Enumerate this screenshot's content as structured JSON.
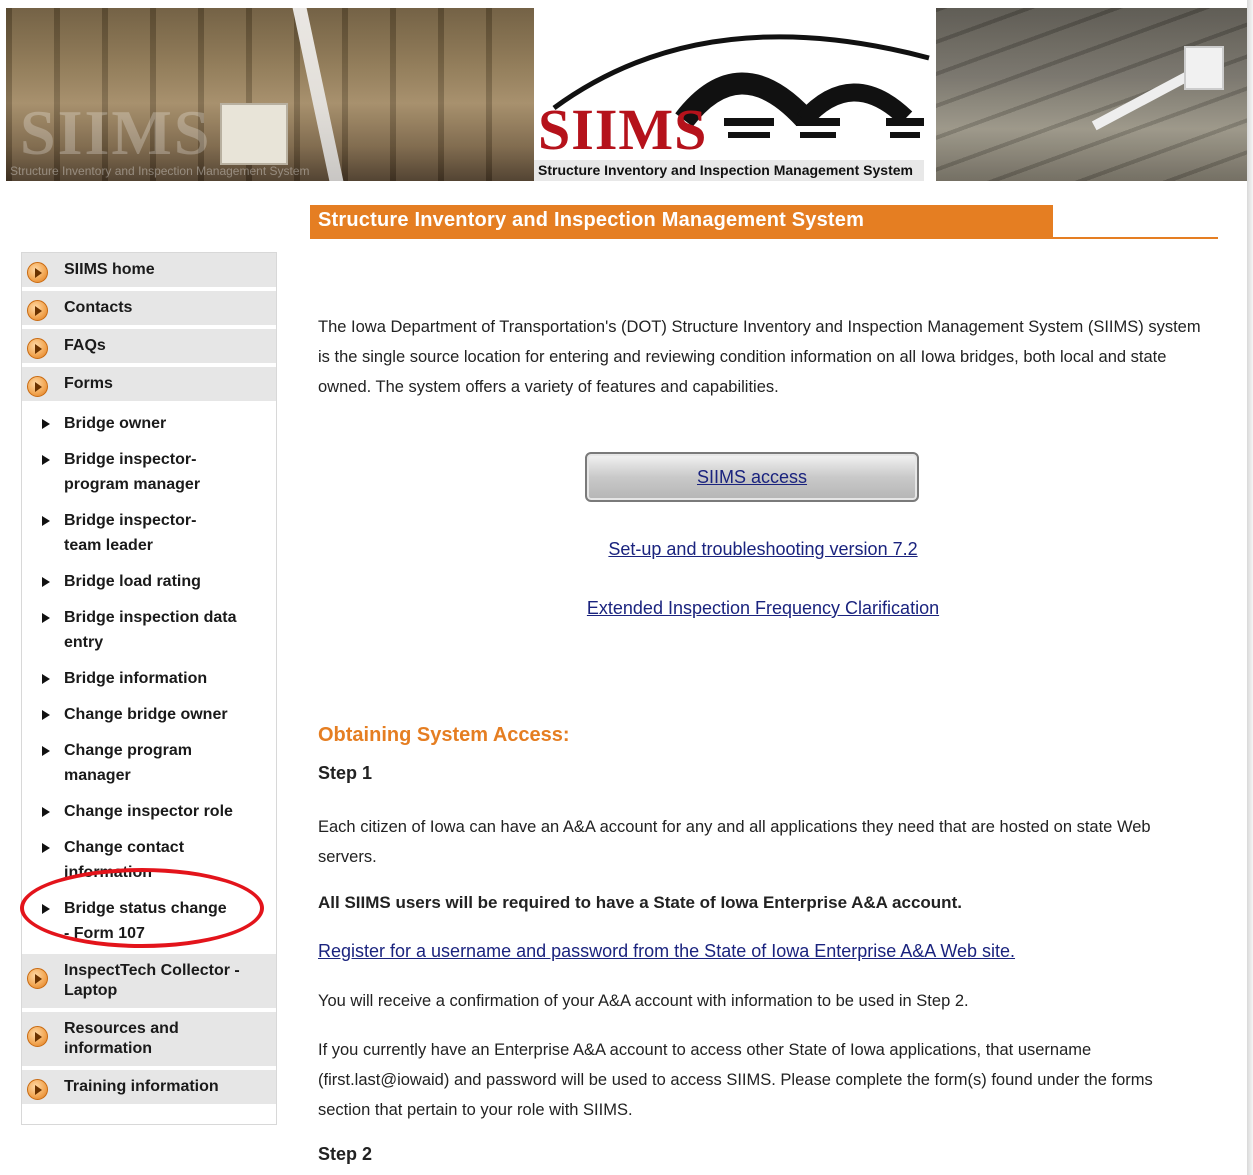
{
  "banner": {
    "ghost_logo": "SIIMS",
    "ghost_subtitle": "Structure Inventory and Inspection Management System",
    "logo_text": "SIIMS",
    "logo_subtitle": "Structure Inventory and Inspection Management System"
  },
  "page_title": "Structure Inventory and Inspection Management System",
  "sidebar": {
    "top_items": [
      {
        "label": "SIIMS home"
      },
      {
        "label": "Contacts"
      },
      {
        "label": "FAQs"
      },
      {
        "label": "Forms"
      }
    ],
    "forms_subitems": [
      {
        "label": "Bridge owner"
      },
      {
        "label": "Bridge inspector-program manager"
      },
      {
        "label": "Bridge inspector-team leader"
      },
      {
        "label": "Bridge load rating"
      },
      {
        "label": "Bridge inspection data entry"
      },
      {
        "label": "Bridge information"
      },
      {
        "label": "Change bridge owner"
      },
      {
        "label": "Change program manager"
      },
      {
        "label": "Change inspector role"
      },
      {
        "label": "Change contact information"
      },
      {
        "label": "Bridge status change - Form 107"
      }
    ],
    "bottom_items": [
      {
        "label": "InspectTech Collector - Laptop"
      },
      {
        "label": "Resources and information"
      },
      {
        "label": "Training information"
      }
    ]
  },
  "content": {
    "intro": "The Iowa Department of Transportation's (DOT) Structure Inventory and Inspection Management System (SIIMS) system is the single source location for entering and reviewing condition information on all Iowa bridges, both local and state owned. The system offers a variety of features and capabilities.",
    "access_button": "SIIMS access",
    "link_setup": "Set-up and troubleshooting version 7.2",
    "link_extended": "Extended Inspection Frequency Clarification",
    "section_heading": "Obtaining System Access:",
    "step1": "Step 1",
    "p1": "Each citizen of Iowa can have an A&A account for any and all applications they need that are hosted on state Web servers.",
    "p2": "All SIIMS users will be required to have a State of Iowa Enterprise A&A account.",
    "p3_link": "Register for a username and password from the State of Iowa Enterprise A&A Web site.",
    "p4": "You will receive a confirmation of your A&A account with information to be used in Step 2.",
    "p5": "If you currently have an Enterprise A&A account to access other State of Iowa applications, that username (first.last@iowaid) and password will be used to access SIIMS. Please complete the form(s) found under the forms section that pertain to your role with SIIMS.",
    "step2": "Step 2"
  },
  "colors": {
    "accent_orange": "#e57e22",
    "logo_red": "#b5121b",
    "highlight_red": "#e3141b",
    "link_blue": "#1a237e"
  }
}
